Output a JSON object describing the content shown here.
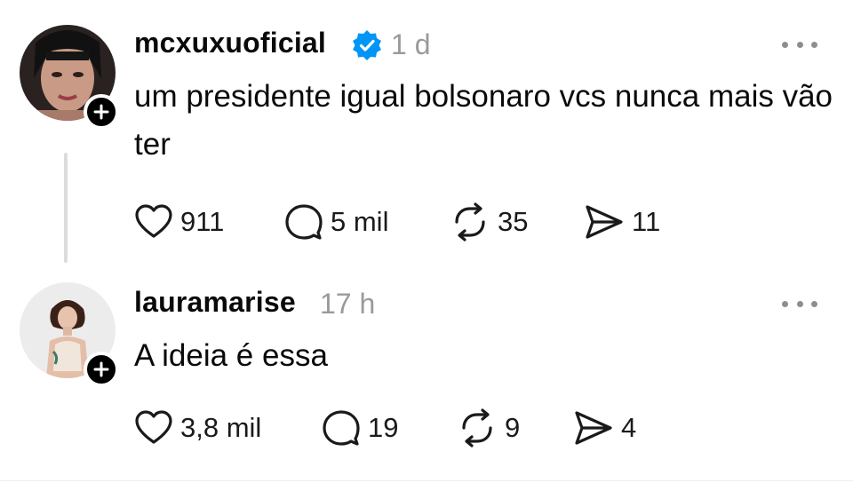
{
  "posts": [
    {
      "username": "mcxuxuoficial",
      "verified": true,
      "time": "1 d",
      "text": "um presidente igual bolsonaro vcs nunca mais vão ter",
      "likes": "911",
      "replies": "5 mil",
      "reposts": "35",
      "shares": "11"
    },
    {
      "username": "lauramarise",
      "verified": false,
      "time": "17 h",
      "text": "A ideia é essa",
      "likes": "3,8 mil",
      "replies": "19",
      "reposts": "9",
      "shares": "4"
    }
  ],
  "colors": {
    "verified_blue": "#0095f6",
    "muted": "#9a9a9a",
    "text": "#0a0a0a"
  },
  "icons": [
    "heart-icon",
    "comment-icon",
    "repost-icon",
    "share-icon",
    "more-icon",
    "plus-icon",
    "verified-icon"
  ]
}
